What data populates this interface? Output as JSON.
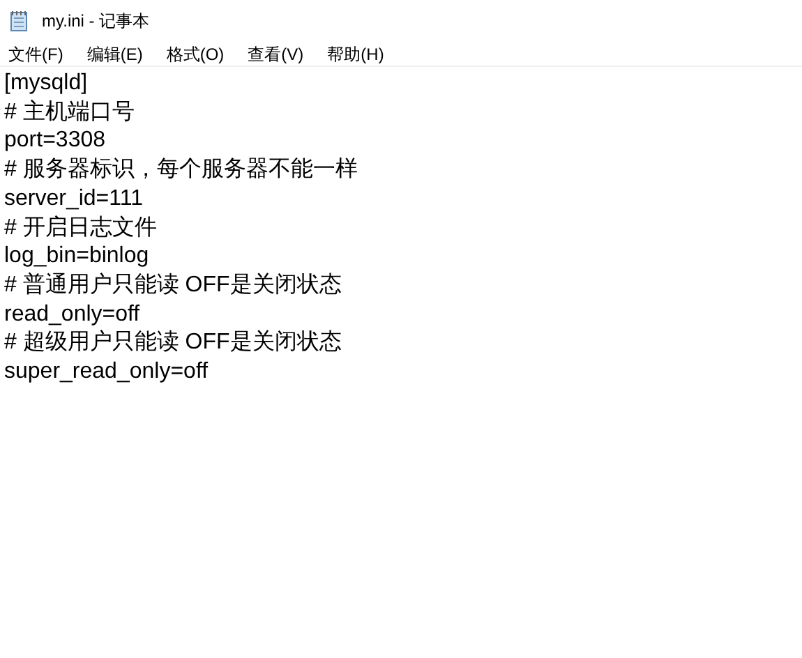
{
  "window": {
    "title": "my.ini - 记事本"
  },
  "menu": [
    "文件(F)",
    "编辑(E)",
    "格式(O)",
    "查看(V)",
    "帮助(H)"
  ],
  "lines": [
    "[mysqld]",
    "# 主机端口号",
    "port=3308",
    "# 服务器标识，每个服务器不能一样",
    "server_id=111",
    "# 开启日志文件",
    "log_bin=binlog",
    "# 普通用户只能读 OFF是关闭状态",
    "read_only=off",
    "# 超级用户只能读 OFF是关闭状态",
    "super_read_only=off"
  ]
}
